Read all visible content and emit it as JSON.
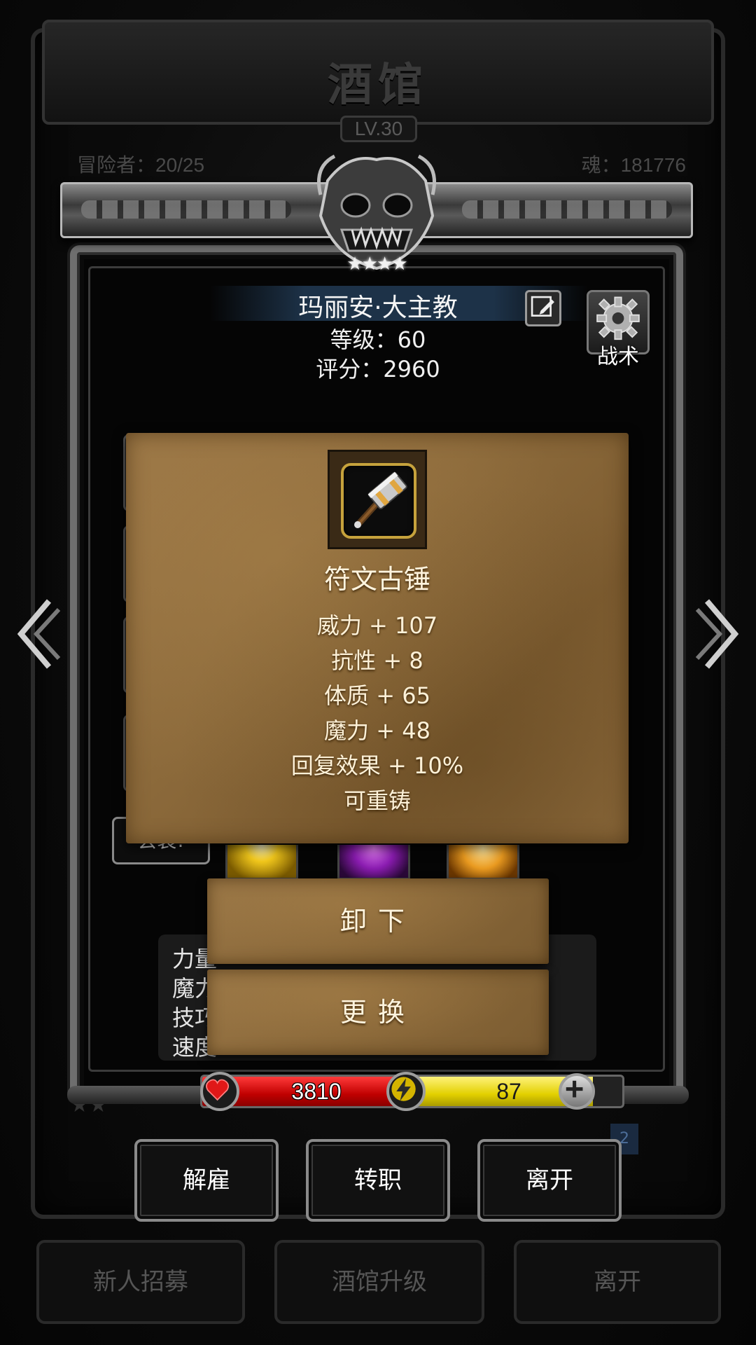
{
  "background": {
    "title": "酒馆",
    "level": "LV.30",
    "adventurers": "冒险者：20/25",
    "soul": "魂：181776",
    "buttons": [
      "新人招募",
      "酒馆升级",
      "离开"
    ],
    "page_badge": "2"
  },
  "character": {
    "name": "玛丽安·大主教",
    "level": "等级：60",
    "score": "评分：2960",
    "stars": "★★★★",
    "tactics_label": "战术",
    "appearance_button": "会装!"
  },
  "stats": {
    "lines": [
      "力量",
      "魔力",
      "技巧",
      "速度"
    ]
  },
  "item_tooltip": {
    "name": "符文古锤",
    "icon": "hammer-icon",
    "attributes": [
      "威力 + 107",
      "抗性 + 8",
      "体质 + 65",
      "魔力 + 48",
      "回复效果 + 10%",
      "可重铸"
    ]
  },
  "actions": {
    "unequip": "卸下",
    "replace": "更换"
  },
  "bars": {
    "hp": "3810",
    "mp": "87",
    "mp_fraction": 0.87
  },
  "footer": {
    "dismiss": "解雇",
    "change_job": "转职",
    "leave": "离开"
  },
  "colors": {
    "hp": "#d40000",
    "mp": "#e2d000",
    "parchment": "#8c6a3b",
    "item_frame": "#c6a23c",
    "name_band": "#1d3248"
  }
}
